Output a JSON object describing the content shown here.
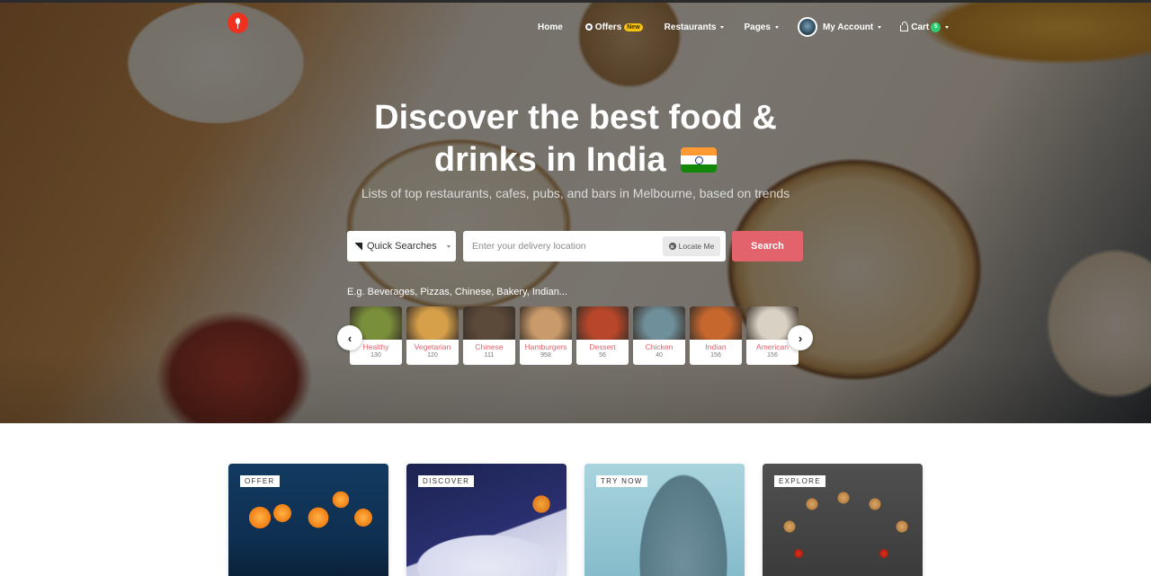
{
  "nav": {
    "logo": "spoon-logo",
    "items": [
      {
        "label": "Home",
        "icon": null,
        "caret": false
      },
      {
        "label": "Offers",
        "icon": "offer-icon",
        "badge": "New",
        "caret": false
      },
      {
        "label": "Restaurants",
        "caret": true
      },
      {
        "label": "Pages",
        "caret": true
      },
      {
        "label": "My Account",
        "icon": "avatar",
        "caret": true
      },
      {
        "label": "Cart",
        "icon": "cart-icon",
        "badge": "5",
        "caret": true
      }
    ]
  },
  "hero": {
    "title_line1": "Discover the best food &",
    "title_line2": "drinks in India",
    "flag": "india-flag",
    "subtitle": "Lists of top restaurants, cafes, pubs, and bars in Melbourne, based on trends"
  },
  "search": {
    "quick_searches_label": "Quick Searches",
    "location_placeholder": "Enter your delivery location",
    "location_value": "",
    "locate_label": "Locate Me",
    "search_label": "Search",
    "examples": "E.g. Beverages, Pizzas, Chinese, Bakery, Indian..."
  },
  "categories": [
    {
      "name": "Healthy",
      "count": "130",
      "color": "#7a8f3a"
    },
    {
      "name": "Vegetarian",
      "count": "120",
      "color": "#d6a04a"
    },
    {
      "name": "Chinese",
      "count": "111",
      "color": "#5b4a3a"
    },
    {
      "name": "Hamburgers",
      "count": "958",
      "color": "#c99a6a"
    },
    {
      "name": "Dessert",
      "count": "56",
      "color": "#b8462a"
    },
    {
      "name": "Chicken",
      "count": "40",
      "color": "#6f8f9a"
    },
    {
      "name": "Indian",
      "count": "156",
      "color": "#c6672e"
    },
    {
      "name": "American",
      "count": "156",
      "color": "#d9d2c4"
    }
  ],
  "carousel": {
    "prev": "‹",
    "next": "›"
  },
  "promos": [
    {
      "tag": "OFFER"
    },
    {
      "tag": "DISCOVER"
    },
    {
      "tag": "TRY NOW"
    },
    {
      "tag": "EXPLORE"
    }
  ],
  "colors": {
    "accent": "#e2636c",
    "logo": "#f0311f",
    "badge_new": "#f5c30f",
    "cart_badge": "#2ecc71"
  }
}
